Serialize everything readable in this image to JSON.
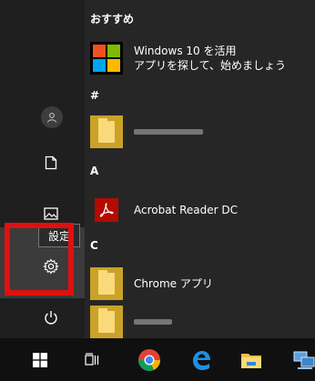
{
  "start_menu": {
    "sections": {
      "recommended": "おすすめ",
      "hash": "#",
      "a": "A",
      "c": "C"
    },
    "apps": {
      "windows10": {
        "line1": "Windows 10 を活用",
        "line2": "アプリを探して、始めましょう",
        "icon": "windows-logo-icon"
      },
      "blurred_app_1": {
        "label": "",
        "icon": "folder-icon"
      },
      "acrobat": {
        "label": "Acrobat Reader DC",
        "icon": "acrobat-icon"
      },
      "chrome_apps": {
        "label": "Chrome アプリ",
        "icon": "folder-icon"
      },
      "blurred_app_2": {
        "label": "",
        "icon": "folder-icon"
      }
    },
    "rail": {
      "avatar_icon": "user-icon",
      "documents_icon": "document-icon",
      "pictures_icon": "pictures-icon",
      "settings_icon": "gear-icon",
      "power_icon": "power-icon",
      "tooltip": "設定"
    }
  },
  "taskbar": {
    "items": [
      "windows-start-icon",
      "task-view-icon",
      "chrome-icon",
      "edge-icon",
      "file-explorer-icon",
      "network-icon"
    ]
  },
  "colors": {
    "highlight": "#e01010",
    "menu_bg": "#262626",
    "tile_folder": "#c9a227"
  }
}
